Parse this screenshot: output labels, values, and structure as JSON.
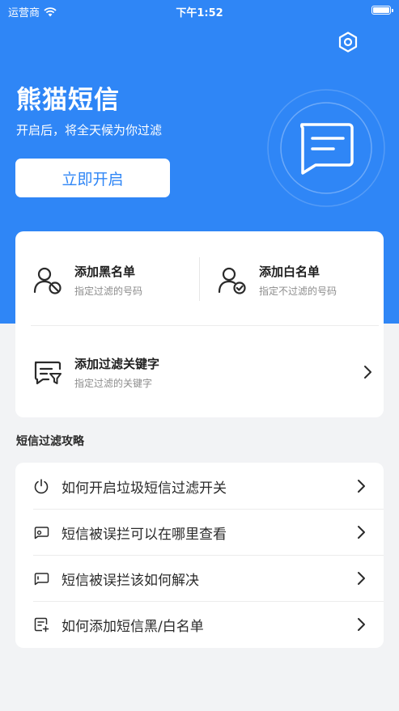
{
  "status_bar": {
    "carrier": "运营商",
    "time": "下午1:52"
  },
  "app": {
    "title": "熊猫短信",
    "subtitle": "开启后，将全天候为你过滤",
    "enable_button": "立即开启"
  },
  "actions": {
    "blacklist": {
      "title": "添加黑名单",
      "desc": "指定过滤的号码",
      "icon": "user-block-icon"
    },
    "whitelist": {
      "title": "添加白名单",
      "desc": "指定不过滤的号码",
      "icon": "user-check-icon"
    },
    "keyword": {
      "title": "添加过滤关键字",
      "desc": "指定过滤的关键字",
      "icon": "message-filter-icon"
    }
  },
  "tips": {
    "section_title": "短信过滤攻略",
    "items": [
      {
        "label": "如何开启垃圾短信过滤开关",
        "icon": "power-icon"
      },
      {
        "label": "短信被误拦可以在哪里查看",
        "icon": "message-view-icon"
      },
      {
        "label": "短信被误拦该如何解决",
        "icon": "message-fix-icon"
      },
      {
        "label": "如何添加短信黑/白名单",
        "icon": "list-add-icon"
      }
    ]
  },
  "colors": {
    "brand": "#2f86f6",
    "background": "#f2f3f5",
    "card": "#ffffff"
  }
}
